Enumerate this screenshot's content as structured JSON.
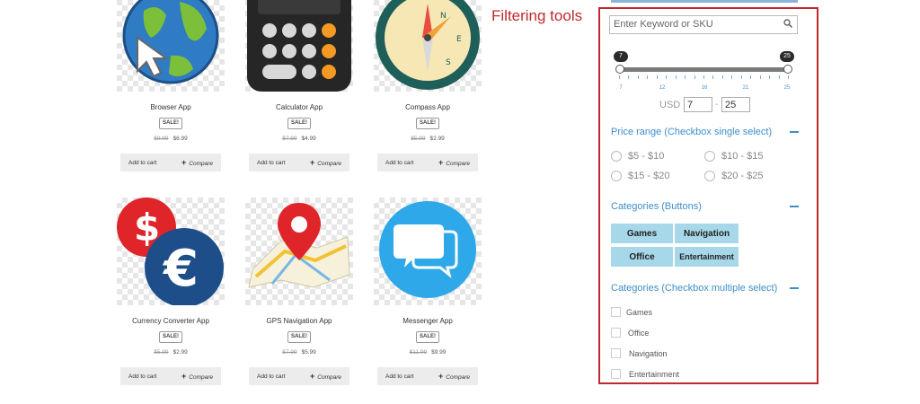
{
  "products": [
    {
      "name": "Browser App",
      "badge": "SALE!",
      "old_price": "$9.99",
      "new_price": "$6.99",
      "icon": "globe-cursor-icon"
    },
    {
      "name": "Calculator App",
      "badge": "SALE!",
      "old_price": "$7.99",
      "new_price": "$4.99",
      "icon": "calculator-icon"
    },
    {
      "name": "Compass App",
      "badge": "SALE!",
      "old_price": "$5.99",
      "new_price": "$2.99",
      "icon": "compass-icon"
    },
    {
      "name": "Currency Converter App",
      "badge": "SALE!",
      "old_price": "$5.99",
      "new_price": "$2.99",
      "icon": "currency-icon"
    },
    {
      "name": "GPS Navigation App",
      "badge": "SALE!",
      "old_price": "$7.99",
      "new_price": "$5.99",
      "icon": "map-pin-icon"
    },
    {
      "name": "Messenger App",
      "badge": "SALE!",
      "old_price": "$11.99",
      "new_price": "$9.99",
      "icon": "chat-bubbles-icon"
    }
  ],
  "buttons": {
    "add_to_cart": "Add to cart",
    "compare": "Compare",
    "compare_plus": "+"
  },
  "annotation": "Filtering tools",
  "filters": {
    "search_placeholder": "Enter Keyword or SKU",
    "slider": {
      "min": 7,
      "max": 25,
      "low": "7",
      "high": "25",
      "tick_labels": [
        "7",
        "12",
        "16",
        "21",
        "25"
      ]
    },
    "currency": "USD",
    "range_low": "7",
    "range_dash": "-",
    "range_high": "25",
    "price_range": {
      "title": "Price range (Checkbox single select)",
      "options": [
        "$5 - $10",
        "$10 - $15",
        "$15 - $20",
        "$20 - $25"
      ]
    },
    "categories_buttons": {
      "title": "Categories (Buttons)",
      "items": [
        "Games",
        "Navigation",
        "Office",
        "Entertainment"
      ]
    },
    "categories_checkbox": {
      "title": "Categories (Checkbox multiple select)",
      "items": [
        "Games",
        "Office",
        "Navigation",
        "Entertainment"
      ]
    },
    "colors": {
      "accent": "#3d8ec9",
      "annotation": "#c0282d",
      "button_bg": "#a6d8ea"
    }
  }
}
